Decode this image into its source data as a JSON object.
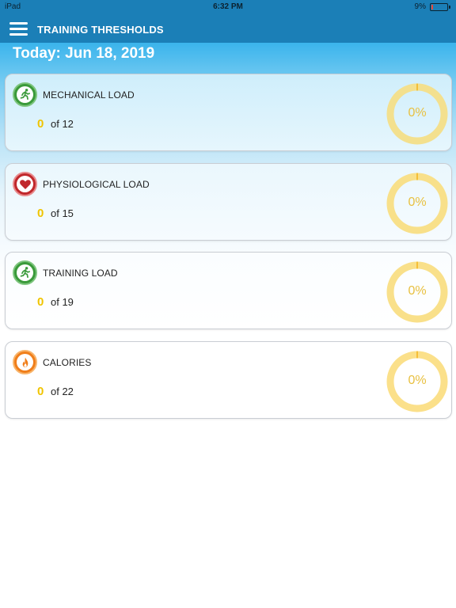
{
  "status_bar": {
    "carrier": "iPad",
    "time": "6:32 PM",
    "battery": "9%",
    "battery_level": 0.09
  },
  "header": {
    "title": "TRAINING THRESHOLDS",
    "menu_icon": "hamburger-menu-icon"
  },
  "date_title": "Today: Jun 18, 2019",
  "colors": {
    "header": "#1b7fb7",
    "value": "#f0c400",
    "gauge_ring": "#f7de85",
    "gauge_progress": "#f2a900",
    "mechanical_icon": "#3a9a3a",
    "physiological_icon": "#c0282c",
    "training_icon": "#3a9a3a",
    "calories_icon": "#f07e1a"
  },
  "cards": [
    {
      "label": "MECHANICAL LOAD",
      "icon": "running-person-icon",
      "value": "0",
      "of_text": "of 12",
      "percent_label": "0%",
      "percent": 0
    },
    {
      "label": "PHYSIOLOGICAL LOAD",
      "icon": "heart-icon",
      "value": "0",
      "of_text": "of 15",
      "percent_label": "0%",
      "percent": 0
    },
    {
      "label": "TRAINING LOAD",
      "icon": "running-person-icon",
      "value": "0",
      "of_text": "of 19",
      "percent_label": "0%",
      "percent": 0
    },
    {
      "label": "CALORIES",
      "icon": "flame-icon",
      "value": "0",
      "of_text": "of 22",
      "percent_label": "0%",
      "percent": 0
    }
  ]
}
